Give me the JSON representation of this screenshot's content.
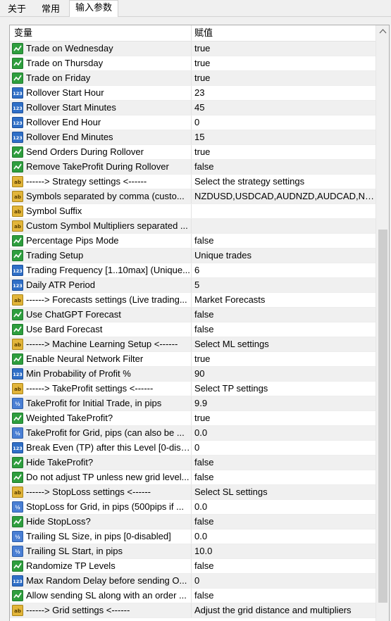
{
  "tabs": [
    {
      "label": "关于",
      "active": false
    },
    {
      "label": "常用",
      "active": false
    },
    {
      "label": "输入参数",
      "active": true
    }
  ],
  "columns": {
    "name": "变量",
    "value": "赋值"
  },
  "rows": [
    {
      "type": "bool",
      "name": "Trade on Wednesday",
      "value": "true"
    },
    {
      "type": "bool",
      "name": "Trade on Thursday",
      "value": "true"
    },
    {
      "type": "bool",
      "name": "Trade on Friday",
      "value": "true"
    },
    {
      "type": "int",
      "name": "Rollover Start Hour",
      "value": "23"
    },
    {
      "type": "int",
      "name": "Rollover Start Minutes",
      "value": "45"
    },
    {
      "type": "int",
      "name": "Rollover End Hour",
      "value": "0"
    },
    {
      "type": "int",
      "name": "Rollover End Minutes",
      "value": "15"
    },
    {
      "type": "bool",
      "name": "Send Orders During Rollover",
      "value": "true"
    },
    {
      "type": "bool",
      "name": "Remove TakeProfit During Rollover",
      "value": "false"
    },
    {
      "type": "string",
      "name": "------> Strategy settings <------",
      "value": "Select the strategy settings"
    },
    {
      "type": "string",
      "name": "Symbols separated by comma (custo...",
      "value": "NZDUSD,USDCAD,AUDNZD,AUDCAD,NZD..."
    },
    {
      "type": "string",
      "name": "Symbol Suffix",
      "value": ""
    },
    {
      "type": "string",
      "name": "Custom Symbol Multipliers separated ...",
      "value": ""
    },
    {
      "type": "bool",
      "name": "Percentage Pips Mode",
      "value": "false"
    },
    {
      "type": "bool",
      "name": "Trading Setup",
      "value": "Unique trades"
    },
    {
      "type": "int",
      "name": "Trading Frequency [1..10max] (Unique...",
      "value": "6"
    },
    {
      "type": "int",
      "name": "Daily ATR Period",
      "value": "5"
    },
    {
      "type": "string",
      "name": "------> Forecasts settings (Live trading...",
      "value": "Market Forecasts"
    },
    {
      "type": "bool",
      "name": "Use ChatGPT Forecast",
      "value": "false"
    },
    {
      "type": "bool",
      "name": "Use Bard Forecast",
      "value": "false"
    },
    {
      "type": "string",
      "name": "------> Machine Learning Setup <------",
      "value": "Select ML settings"
    },
    {
      "type": "bool",
      "name": "Enable Neural Network Filter",
      "value": "true"
    },
    {
      "type": "int",
      "name": "Min Probability of Profit %",
      "value": "90"
    },
    {
      "type": "string",
      "name": "------> TakeProfit settings <------",
      "value": "Select TP settings"
    },
    {
      "type": "double",
      "name": "TakeProfit for Initial Trade, in pips",
      "value": "9.9"
    },
    {
      "type": "bool",
      "name": "Weighted TakeProfit?",
      "value": "true"
    },
    {
      "type": "double",
      "name": "TakeProfit for Grid, pips (can also be ...",
      "value": "0.0"
    },
    {
      "type": "int",
      "name": "Break Even (TP) after this Level [0-disa...",
      "value": "0"
    },
    {
      "type": "bool",
      "name": "Hide TakeProfit?",
      "value": "false"
    },
    {
      "type": "bool",
      "name": "Do not adjust TP unless new grid level...",
      "value": "false"
    },
    {
      "type": "string",
      "name": "------> StopLoss settings <------",
      "value": "Select SL settings"
    },
    {
      "type": "double",
      "name": "StopLoss for Grid, in pips (500pips if ...",
      "value": "0.0"
    },
    {
      "type": "bool",
      "name": "Hide StopLoss?",
      "value": "false"
    },
    {
      "type": "double",
      "name": "Trailing SL Size, in pips [0-disabled]",
      "value": "0.0"
    },
    {
      "type": "double",
      "name": "Trailing SL Start, in pips",
      "value": "10.0"
    },
    {
      "type": "bool",
      "name": "Randomize TP Levels",
      "value": "false"
    },
    {
      "type": "int",
      "name": "Max Random Delay before sending O...",
      "value": "0"
    },
    {
      "type": "bool",
      "name": "Allow sending SL along with an order ...",
      "value": "false"
    },
    {
      "type": "string",
      "name": "------> Grid settings <------",
      "value": "Adjust the grid distance and multipliers"
    }
  ],
  "icon_names": {
    "bool": "bool-param-icon",
    "int": "int-param-icon",
    "double": "double-param-icon",
    "string": "string-param-icon"
  },
  "colors": {
    "alt_row": "#f0f0f0",
    "scroll_thumb": "#cdcdcd"
  }
}
